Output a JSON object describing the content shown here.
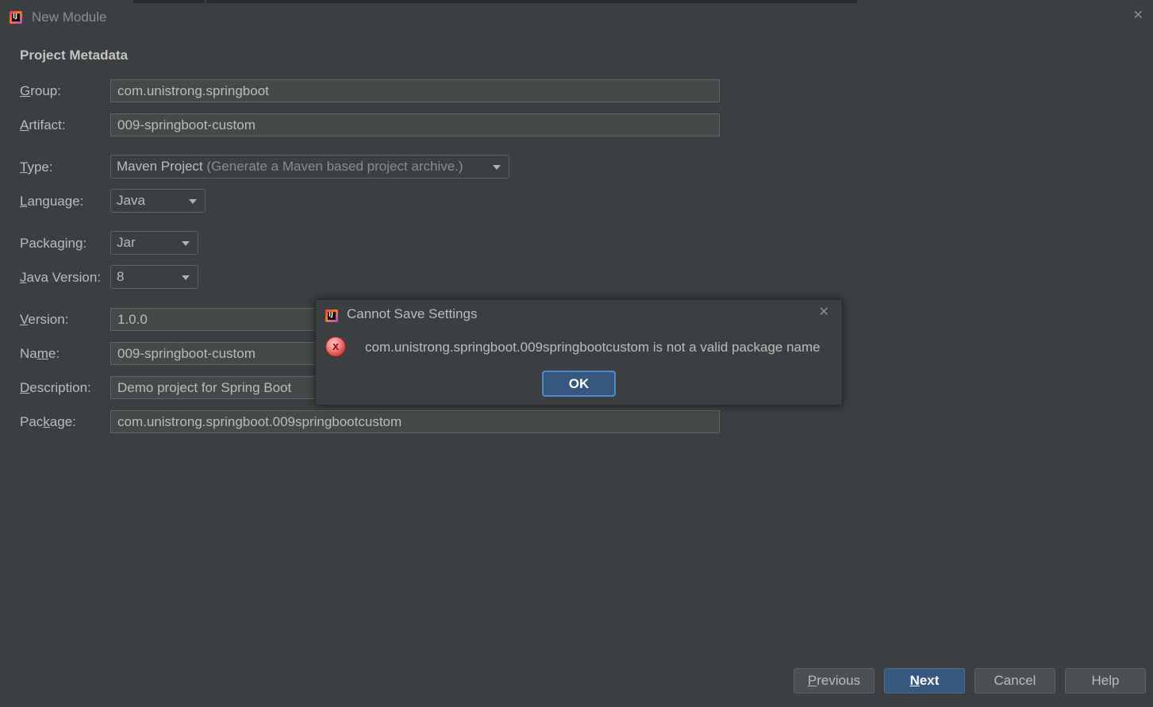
{
  "window": {
    "title": "New Module"
  },
  "section_title": "Project Metadata",
  "form": {
    "group": {
      "label_pre": "",
      "label_mnemonic": "G",
      "label_post": "roup:",
      "value": "com.unistrong.springboot"
    },
    "artifact": {
      "label_pre": "",
      "label_mnemonic": "A",
      "label_post": "rtifact:",
      "value": "009-springboot-custom"
    },
    "type": {
      "label_pre": "",
      "label_mnemonic": "T",
      "label_post": "ype:",
      "value": "Maven Project",
      "hint": "(Generate a Maven based project archive.)"
    },
    "language": {
      "label_pre": "",
      "label_mnemonic": "L",
      "label_post": "anguage:",
      "value": "Java"
    },
    "packaging": {
      "label_pre": "Packa",
      "label_mnemonic": "g",
      "label_post": "ing:",
      "value": "Jar"
    },
    "java_version": {
      "label_pre": "",
      "label_mnemonic": "J",
      "label_post": "ava Version:",
      "value": "8"
    },
    "version": {
      "label_pre": "",
      "label_mnemonic": "V",
      "label_post": "ersion:",
      "value": "1.0.0"
    },
    "name": {
      "label_pre": "Na",
      "label_mnemonic": "m",
      "label_post": "e:",
      "value": "009-springboot-custom"
    },
    "description": {
      "label_pre": "",
      "label_mnemonic": "D",
      "label_post": "escription:",
      "value": "Demo project for Spring Boot"
    },
    "package": {
      "label_pre": "Pac",
      "label_mnemonic": "k",
      "label_post": "age:",
      "value": "com.unistrong.springboot.009springbootcustom"
    }
  },
  "dialog": {
    "title": "Cannot Save Settings",
    "message": "com.unistrong.springboot.009springbootcustom is not a valid package name",
    "icon": "error-icon",
    "ok_label": "OK"
  },
  "buttons": {
    "previous": {
      "mnemonic": "P",
      "rest": "revious"
    },
    "next": {
      "mnemonic": "N",
      "rest": "ext"
    },
    "cancel": {
      "label": "Cancel"
    },
    "help": {
      "label": "Help"
    }
  },
  "icons": {
    "app": "intellij-app-icon",
    "close": "close-icon",
    "dropdown": "chevron-down-icon",
    "error": "error-icon"
  },
  "colors": {
    "background": "#3c3f41",
    "field": "#45494a",
    "accent_button": "#365880",
    "error": "#d43a3a"
  }
}
